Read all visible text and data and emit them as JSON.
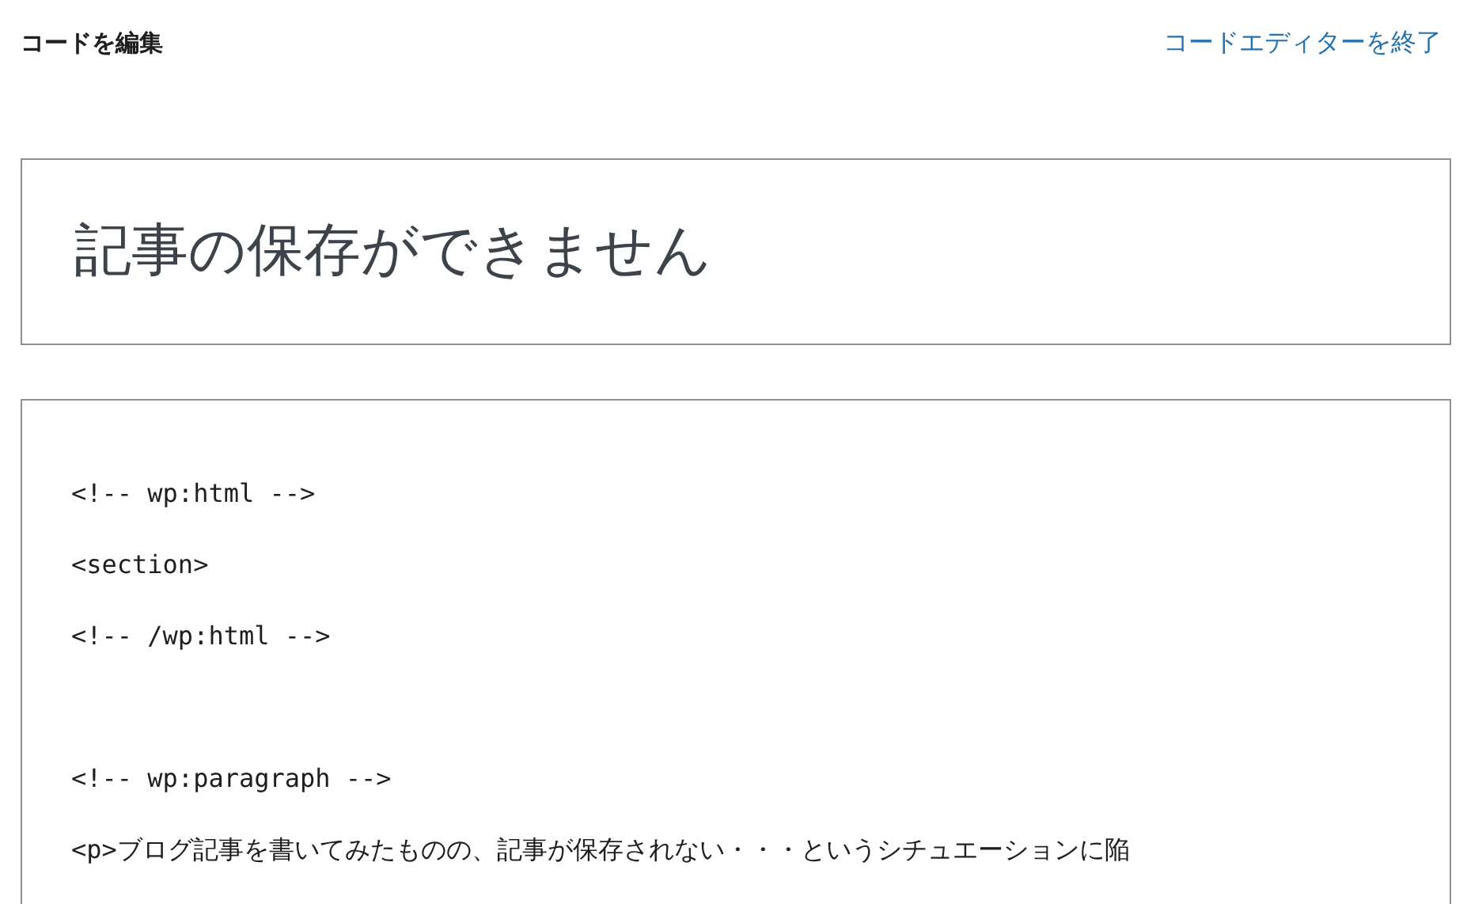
{
  "header": {
    "title": "コードを編集",
    "exit_link": "コードエディターを終了"
  },
  "post_title": "記事の保存ができません",
  "code_blocks": [
    [
      "<!-- wp:html -->",
      "<section>",
      "<!-- /wp:html -->"
    ],
    [
      "<!-- wp:paragraph -->",
      "<p>ブログ記事を書いてみたものの、記事が保存されない・・・というシチュエーションに陥"
    ]
  ]
}
